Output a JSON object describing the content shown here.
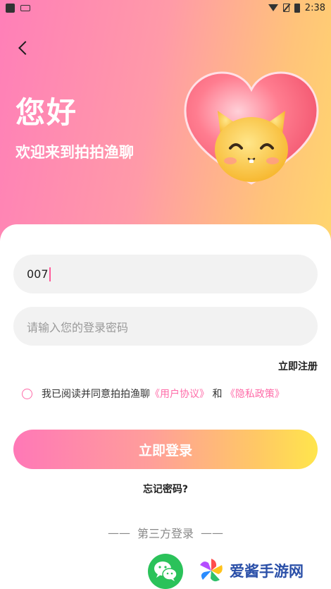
{
  "status_bar": {
    "time": "2:38"
  },
  "header": {
    "greeting": "您好",
    "subtitle": "欢迎来到拍拍渔聊"
  },
  "form": {
    "account_value": "007",
    "password_placeholder": "请输入您的登录密码",
    "register_label": "立即注册",
    "agreement": {
      "prefix": "我已阅读并同意拍拍渔聊",
      "user_agreement": "《用户协议》",
      "conjunction": " 和 ",
      "privacy_policy": "《隐私政策》"
    },
    "login_label": "立即登录",
    "forgot_label": "忘记密码?"
  },
  "third_party": {
    "dash_left": "——",
    "label": "第三方登录",
    "dash_right": "——"
  },
  "watermark": {
    "text": "爱酱手游网"
  }
}
